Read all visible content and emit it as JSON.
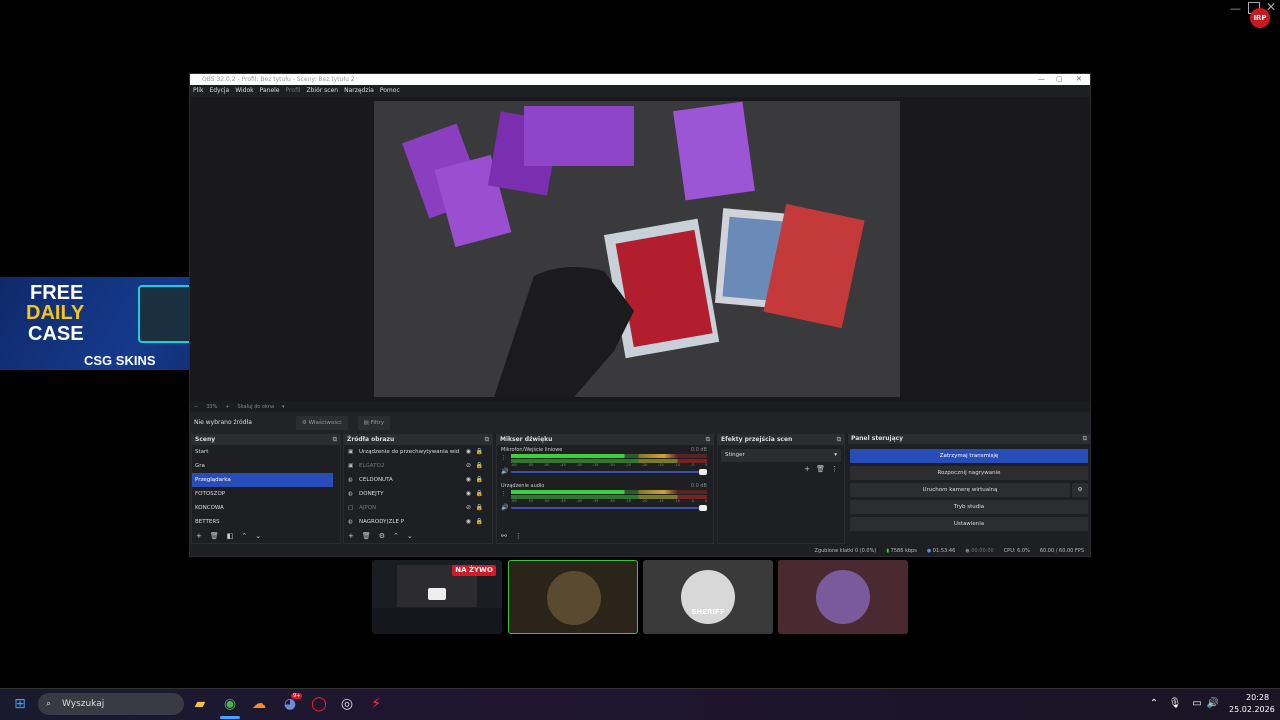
{
  "obs": {
    "title": "OBS 32.0.2 - Profil: Bez tytułu - Sceny: Bez tytułu 2",
    "menu": [
      "Plik",
      "Edycja",
      "Widok",
      "Panele",
      "Profil",
      "Zbiór scen",
      "Narzędzia",
      "Pomoc"
    ],
    "zoom": {
      "percent": "33%",
      "fit_label": "Skaluj do okna"
    },
    "propbar": {
      "no_source": "Nie wybrano źródła",
      "properties": "Właściwości",
      "filters": "Filtry"
    },
    "scenes": {
      "title": "Sceny",
      "items": [
        "Start",
        "Gra",
        "Przeglądarka",
        "FOTOSZOP",
        "KONCOWA",
        "BETTERS"
      ],
      "selected_index": 2
    },
    "sources": {
      "title": "Źródła obrazu",
      "items": [
        {
          "label": "Urządzenie do przechwytywania wid",
          "visible": true
        },
        {
          "label": "ELGATO2",
          "visible": false
        },
        {
          "label": "CELDONUTA",
          "visible": true
        },
        {
          "label": "DONEJTY",
          "visible": true
        },
        {
          "label": "AJPON",
          "visible": false
        },
        {
          "label": "NAGRODY(ZLE P",
          "visible": true
        }
      ]
    },
    "mixer": {
      "title": "Mikser dźwięku",
      "channels": [
        {
          "name": "Mikrofon/Wejście liniowe",
          "db": "0.0 dB"
        },
        {
          "name": "Urządzenie audio",
          "db": "0.0 dB"
        }
      ],
      "scale": [
        "-60",
        "-55",
        "-50",
        "-45",
        "-40",
        "-35",
        "-30",
        "-25",
        "-20",
        "-15",
        "-10",
        "-5",
        "0"
      ]
    },
    "transitions": {
      "title": "Efekty przejścia scen",
      "selected": "Stinger"
    },
    "controls": {
      "title": "Panel sterujący",
      "buttons": [
        "Zatrzymaj transmisję",
        "Rozpocznij nagrywanie",
        "Uruchom kamerę wirtualną",
        "Tryb studia",
        "Ustawienia"
      ]
    },
    "status": {
      "dropped": "Zgubione klatki 0 (0.0%)",
      "bitrate": "7586 kbps",
      "live_time": "01:53:46",
      "rec_time": "00:00:00",
      "cpu": "CPU: 6.0%",
      "fps": "60.00 / 60.00 FPS"
    }
  },
  "ad": {
    "line1": "FREE",
    "line2": "DAILY",
    "line3": "CASE",
    "brand": "CSG SKINS"
  },
  "call": {
    "live_label": "NA ŻYWO",
    "sheriff_label": "SHERIFF"
  },
  "taskbar": {
    "search_placeholder": "Wyszukaj",
    "time": "20:28",
    "date": "25.02.2026",
    "notification_count": "9+"
  },
  "colors": {
    "accent": "#284cb8",
    "live_red": "#d11b2a",
    "ad_yellow": "#f5c518"
  }
}
